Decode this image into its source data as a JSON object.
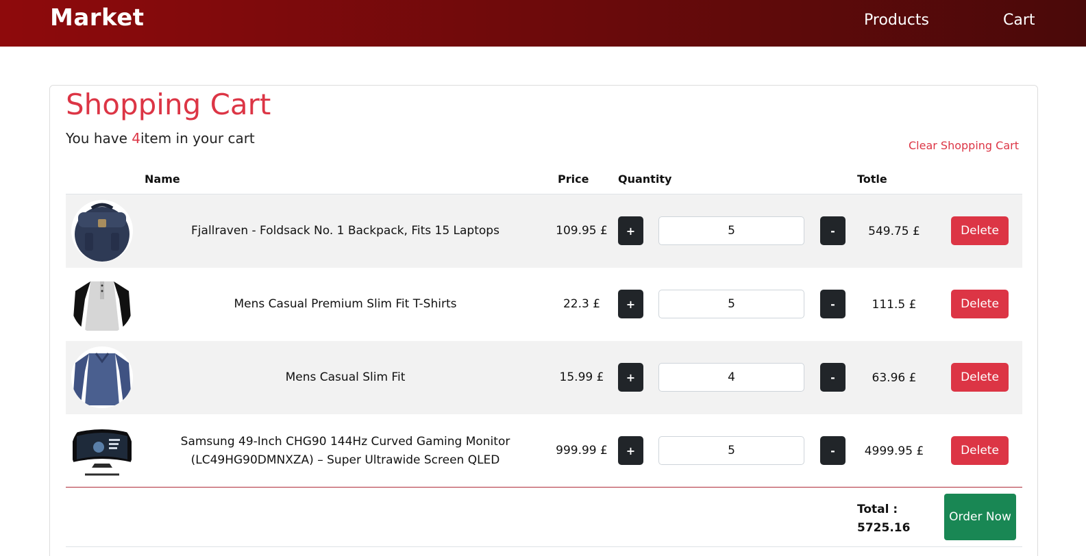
{
  "navbar": {
    "brand": "Market",
    "links": [
      "Products",
      "Cart"
    ]
  },
  "cart": {
    "title": "Shopping Cart",
    "subtitle_prefix": "You have ",
    "item_count": "4",
    "subtitle_suffix": "item in your cart",
    "clear_label": "Clear Shopping Cart",
    "columns": {
      "name": "Name",
      "price": "Price",
      "quantity": "Quantity",
      "total": "Totle"
    },
    "items": [
      {
        "name": "Fjallraven - Foldsack No. 1 Backpack, Fits 15 Laptops",
        "price": "109.95 £",
        "quantity": "5",
        "total": "549.75 £",
        "image": "backpack-image"
      },
      {
        "name": "Mens Casual Premium Slim Fit T-Shirts",
        "price": "22.3 £",
        "quantity": "5",
        "total": "111.5 £",
        "image": "tshirt-image"
      },
      {
        "name": "Mens Casual Slim Fit",
        "price": "15.99 £",
        "quantity": "4",
        "total": "63.96 £",
        "image": "longsleeve-image"
      },
      {
        "name": "Samsung 49-Inch CHG90 144Hz Curved Gaming Monitor (LC49HG90DMNXZA) – Super Ultrawide Screen QLED",
        "price": "999.99 £",
        "quantity": "5",
        "total": "4999.95 £",
        "image": "monitor-image"
      }
    ],
    "plus_label": "+",
    "minus_label": "-",
    "delete_label": "Delete",
    "total_label": "Total :",
    "total_value": "5725.16",
    "order_label": "Order Now"
  },
  "colors": {
    "navbar_start": "#8e0a0c",
    "navbar_end": "#4a0909",
    "accent_red": "#dc3545",
    "dark_button": "#212529",
    "order_green": "#198754"
  }
}
